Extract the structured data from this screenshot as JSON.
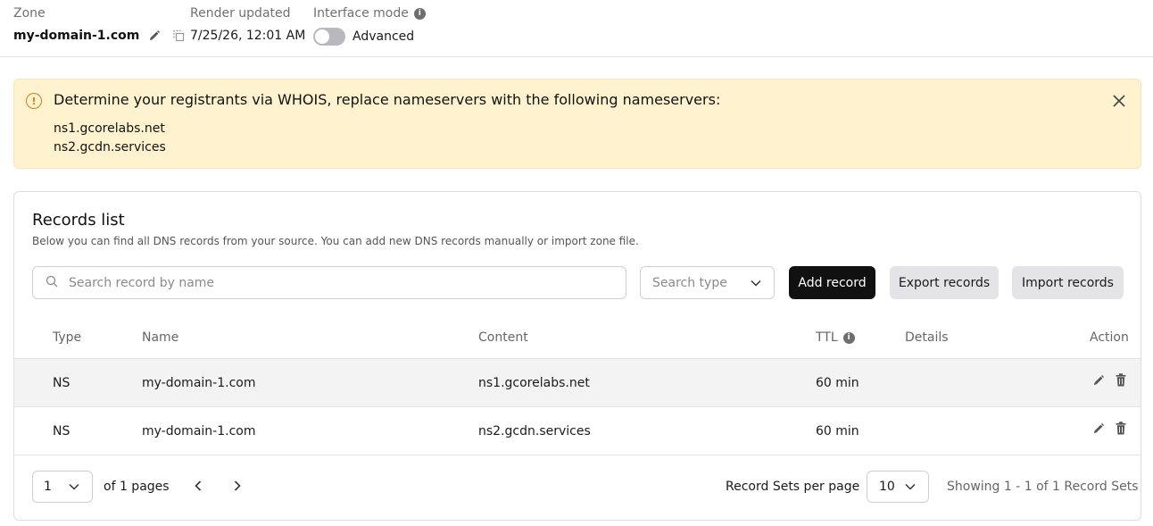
{
  "header": {
    "zone_label": "Zone",
    "zone_name": "my-domain-1.com",
    "render_label": "Render updated",
    "render_value": "7/25/26, 12:01 AM",
    "mode_label": "Interface mode",
    "mode_value": "Advanced",
    "mode_toggle_on": false
  },
  "alert": {
    "title": "Determine your registrants via WHOIS, replace nameservers with the following nameservers:",
    "nameservers": [
      "ns1.gcorelabs.net",
      "ns2.gcdn.services"
    ],
    "accent_color": "#e07b11",
    "background_color": "#fff3cf"
  },
  "records": {
    "title": "Records list",
    "subtitle": "Below you can find all DNS records from your source. You can add new DNS records manually or import zone file.",
    "search_placeholder": "Search record by name",
    "type_placeholder": "Search type",
    "add_label": "Add record",
    "export_label": "Export records",
    "import_label": "Import records",
    "columns": {
      "type": "Type",
      "name": "Name",
      "content": "Content",
      "ttl": "TTL",
      "details": "Details",
      "action": "Action"
    },
    "rows": [
      {
        "type": "NS",
        "name": "my-domain-1.com",
        "content": "ns1.gcorelabs.net",
        "ttl": "60 min",
        "details": ""
      },
      {
        "type": "NS",
        "name": "my-domain-1.com",
        "content": "ns2.gcdn.services",
        "ttl": "60 min",
        "details": ""
      }
    ]
  },
  "pagination": {
    "current_page": "1",
    "of_pages": "of 1 pages",
    "per_page_label": "Record Sets per page",
    "per_page_value": "10",
    "showing": "Showing 1 - 1 of 1 Record Sets"
  },
  "icons": {
    "edit": "pencil-icon",
    "copy": "copy-icon",
    "info": "info-icon",
    "warning": "warning-circle-icon",
    "close": "close-icon",
    "search": "search-icon",
    "chevron": "chevron-down-icon",
    "prev": "chevron-left-icon",
    "next": "chevron-right-icon",
    "delete": "trash-icon"
  }
}
